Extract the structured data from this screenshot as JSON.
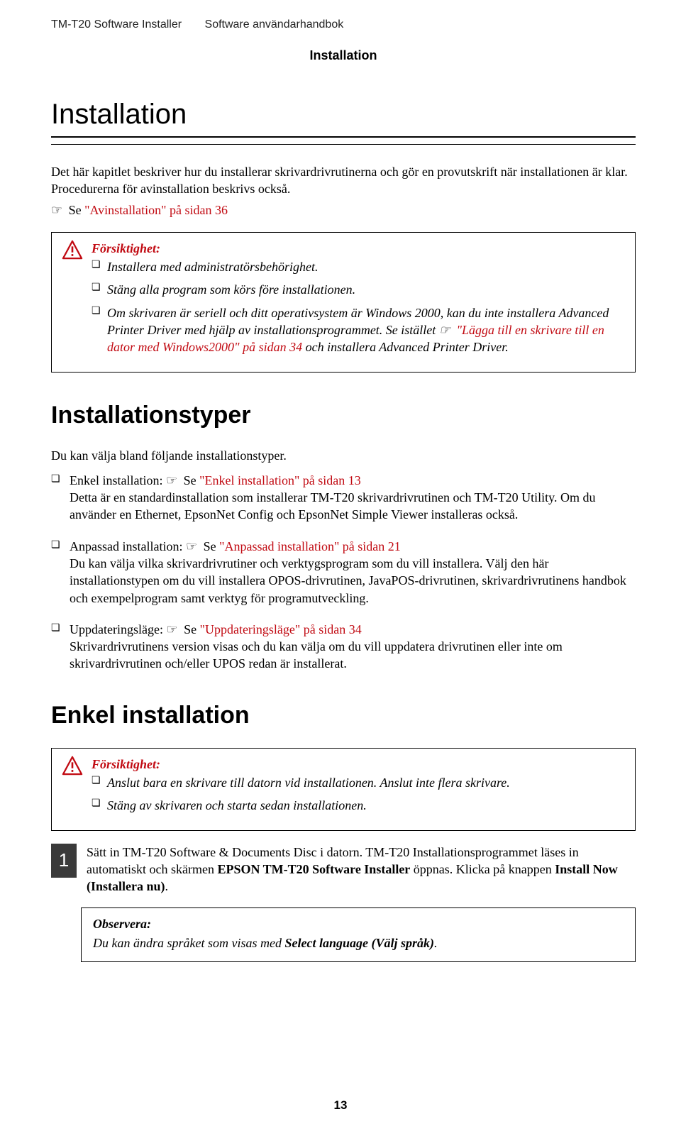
{
  "running_head": {
    "product": "TM-T20 Software Installer",
    "doc": "Software användarhandbok"
  },
  "section_label": "Installation",
  "chapter_title": "Installation",
  "intro": {
    "p1": "Det här kapitlet beskriver hur du installerar skrivardrivrutinerna och gör en provutskrift när installationen är klar. Procedurerna för avinstallation beskrivs också.",
    "see_prefix": "Se ",
    "see_link": "\"Avinstallation\" på sidan 36"
  },
  "caution1": {
    "title": "Försiktighet:",
    "items": [
      "Installera med administratörsbehörighet.",
      "Stäng alla program som körs före installationen."
    ],
    "item3_a": "Om skrivaren är seriell och ditt operativsystem är Windows 2000, kan du inte installera Advanced Printer Driver med hjälp av installationsprogrammet. Se istället ",
    "item3_link": "\"Lägga till en skrivare till en dator med Windows2000\" på sidan 34",
    "item3_b": " och installera Advanced Printer Driver."
  },
  "types": {
    "heading": "Installationstyper",
    "intro": "Du kan välja bland följande installationstyper.",
    "items": [
      {
        "label": "Enkel installation: ",
        "see": "Se ",
        "link": "\"Enkel installation\" på sidan 13",
        "desc": "Detta är en standardinstallation som installerar TM-T20 skrivardrivrutinen och TM-T20 Utility. Om du använder en Ethernet, EpsonNet Config och EpsonNet Simple Viewer installeras också."
      },
      {
        "label": "Anpassad installation: ",
        "see": "Se ",
        "link": "\"Anpassad installation\" på sidan 21",
        "desc": "Du kan välja vilka skrivardrivrutiner och verktygsprogram som du vill installera. Välj den här installationstypen om du vill installera OPOS-drivrutinen, JavaPOS-drivrutinen, skrivardrivrutinens handbok och exempelprogram samt verktyg för programutveckling."
      },
      {
        "label": "Uppdateringsläge: ",
        "see": "Se ",
        "link": "\"Uppdateringsläge\" på sidan 34",
        "desc": "Skrivardrivrutinens version visas och du kan välja om du vill uppdatera drivrutinen eller inte om skrivardrivrutinen och/eller UPOS redan är installerat."
      }
    ]
  },
  "easy": {
    "heading": "Enkel installation"
  },
  "caution2": {
    "title": "Försiktighet:",
    "items": [
      "Anslut bara en skrivare till datorn vid installationen. Anslut inte flera skrivare.",
      "Stäng av skrivaren och starta sedan installationen."
    ]
  },
  "step1": {
    "num": "1",
    "a": "Sätt in TM-T20 Software & Documents Disc i datorn. TM-T20 Installationsprogrammet läses in automatiskt och skärmen ",
    "bold1": "EPSON TM-T20 Software Installer",
    "b": " öppnas. Klicka på knappen ",
    "bold2": "Install Now (Installera nu)",
    "c": "."
  },
  "note1": {
    "title": "Observera:",
    "a": "Du kan ändra språket som visas med ",
    "bold": "Select language (Välj språk)",
    "b": "."
  },
  "page_number": "13",
  "chart_data": null
}
